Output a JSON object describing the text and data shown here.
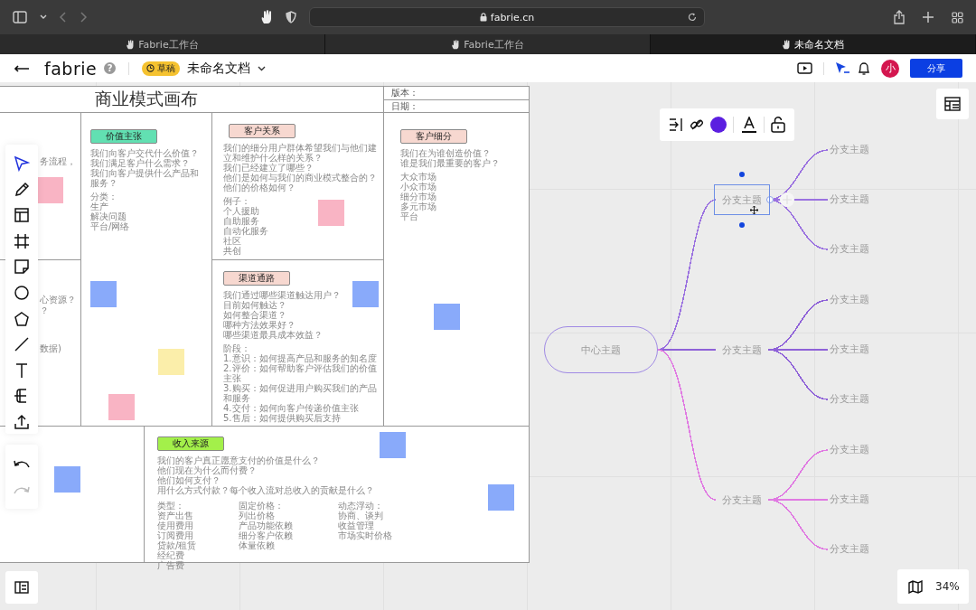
{
  "browser": {
    "url": "fabrie.cn",
    "tabs": [
      {
        "label": "Fabrie工作台",
        "selected": false
      },
      {
        "label": "Fabrie工作台",
        "selected": false
      },
      {
        "label": "未命名文档",
        "selected": true
      }
    ]
  },
  "header": {
    "logo": "fabrie",
    "help": "?",
    "badge": "草稿",
    "title": "未命名文档",
    "avatar": "小",
    "share": "分享"
  },
  "tools": [
    {
      "kind": "select",
      "selected": true
    },
    {
      "kind": "pen",
      "selected": false
    },
    {
      "kind": "layout",
      "selected": false
    },
    {
      "kind": "frame",
      "selected": false
    },
    {
      "kind": "sticky",
      "selected": false
    },
    {
      "kind": "circle",
      "selected": false
    },
    {
      "kind": "polygon",
      "selected": false
    },
    {
      "kind": "line",
      "selected": false
    },
    {
      "kind": "text",
      "selected": false
    },
    {
      "kind": "mindmap",
      "selected": false
    },
    {
      "kind": "upload",
      "selected": false
    }
  ],
  "history": [
    {
      "kind": "undo",
      "disabled": false
    },
    {
      "kind": "redo",
      "disabled": true
    }
  ],
  "board": {
    "title": "商业模式画布",
    "version_label": "版本：",
    "date_label": "日期：",
    "key_activities": {
      "fragments": [
        "务流程，"
      ]
    },
    "key_resources": {
      "fragments": [
        "心资源？",
        "？",
        "数据)"
      ]
    },
    "value_propositions": {
      "tag": "价值主张",
      "color": "#62e0b2",
      "questions": [
        "我们向客户交代什么价值？",
        "我们满足客户什么需求？",
        "我们向客户提供什么产品和服务？"
      ],
      "notes": [
        "分类：",
        "生产",
        "解决问题",
        "平台/网络"
      ]
    },
    "customer_relationships": {
      "tag": "客户关系",
      "color": "#f7d8d0",
      "questions": [
        "我们的细分用户群体希望我们与他们建立和维护什么样的关系？",
        "我们已经建立了哪些？",
        "他们是如何与我们的商业模式整合的？",
        "他们的价格如何？"
      ],
      "notes": [
        "例子：",
        "个人援助",
        "自助服务",
        "自动化服务",
        "社区",
        "共创"
      ]
    },
    "channels": {
      "tag": "渠道通路",
      "color": "#f7d8d0",
      "questions": [
        "我们通过哪些渠道触达用户？",
        "目前如何触达？",
        "如何整合渠道？",
        "哪种方法效果好？",
        "哪些渠道最具成本效益？"
      ],
      "notes": [
        "阶段：",
        "1.意识：如何提高产品和服务的知名度",
        "2.评价：如何帮助客户评估我们的价值主张",
        "3.购买：如何促进用户购买我们的产品和服务",
        "4.交付：如何向客户传递价值主张",
        "5.售后：如何提供购买后支持"
      ]
    },
    "customer_segments": {
      "tag": "客户细分",
      "color": "#f7d8d0",
      "questions": [
        "我们在为谁创造价值？",
        "谁是我们最重要的客户？"
      ],
      "notes": [
        "大众市场",
        "小众市场",
        "细分市场",
        "多元市场",
        "平台"
      ]
    },
    "revenue_streams": {
      "tag": "收入来源",
      "color": "#a3f04a",
      "questions": [
        "我们的客户真正愿意支付的价值是什么？",
        "他们现在为什么而付费？",
        "他们如何支付？",
        "用什么方式付款？每个收入流对总收入的贡献是什么？"
      ],
      "note_columns": [
        [
          "类型：",
          "资产出售",
          "使用费用",
          "订阅费用",
          "贷款/租赁",
          "经纪费",
          "广告费"
        ],
        [
          "固定价格：",
          "列出价格",
          "产品功能依赖",
          "细分客户依赖",
          "体量依赖"
        ],
        [
          "动态浮动：",
          "协商、谈判",
          "收益管理",
          "市场实时价格"
        ]
      ]
    },
    "stickies": [
      {
        "color": "#f9b4c4"
      },
      {
        "color": "#89aafa"
      },
      {
        "color": "#f9b4c4"
      },
      {
        "color": "#fbeeaa"
      },
      {
        "color": "#f9b4c4"
      },
      {
        "color": "#89aafa"
      },
      {
        "color": "#89aafa"
      },
      {
        "color": "#89aafa"
      },
      {
        "color": "#89aafa"
      },
      {
        "color": "#89aafa"
      }
    ]
  },
  "mind_map": {
    "center": "中心主题",
    "branches": [
      {
        "label": "分支主题",
        "color": "#9b72e0",
        "selected": true,
        "children": [
          {
            "label": "分支主题"
          },
          {
            "label": "分支主题"
          },
          {
            "label": "分支主题"
          }
        ]
      },
      {
        "label": "分支主题",
        "color": "#8f62d8",
        "selected": false,
        "children": [
          {
            "label": "分支主题"
          },
          {
            "label": "分支主题"
          },
          {
            "label": "分支主题"
          }
        ]
      },
      {
        "label": "分支主题",
        "color": "#e07ae2",
        "selected": false,
        "children": [
          {
            "label": "分支主题"
          },
          {
            "label": "分支主题"
          },
          {
            "label": "分支主题"
          }
        ]
      }
    ]
  },
  "zoom": "34%"
}
